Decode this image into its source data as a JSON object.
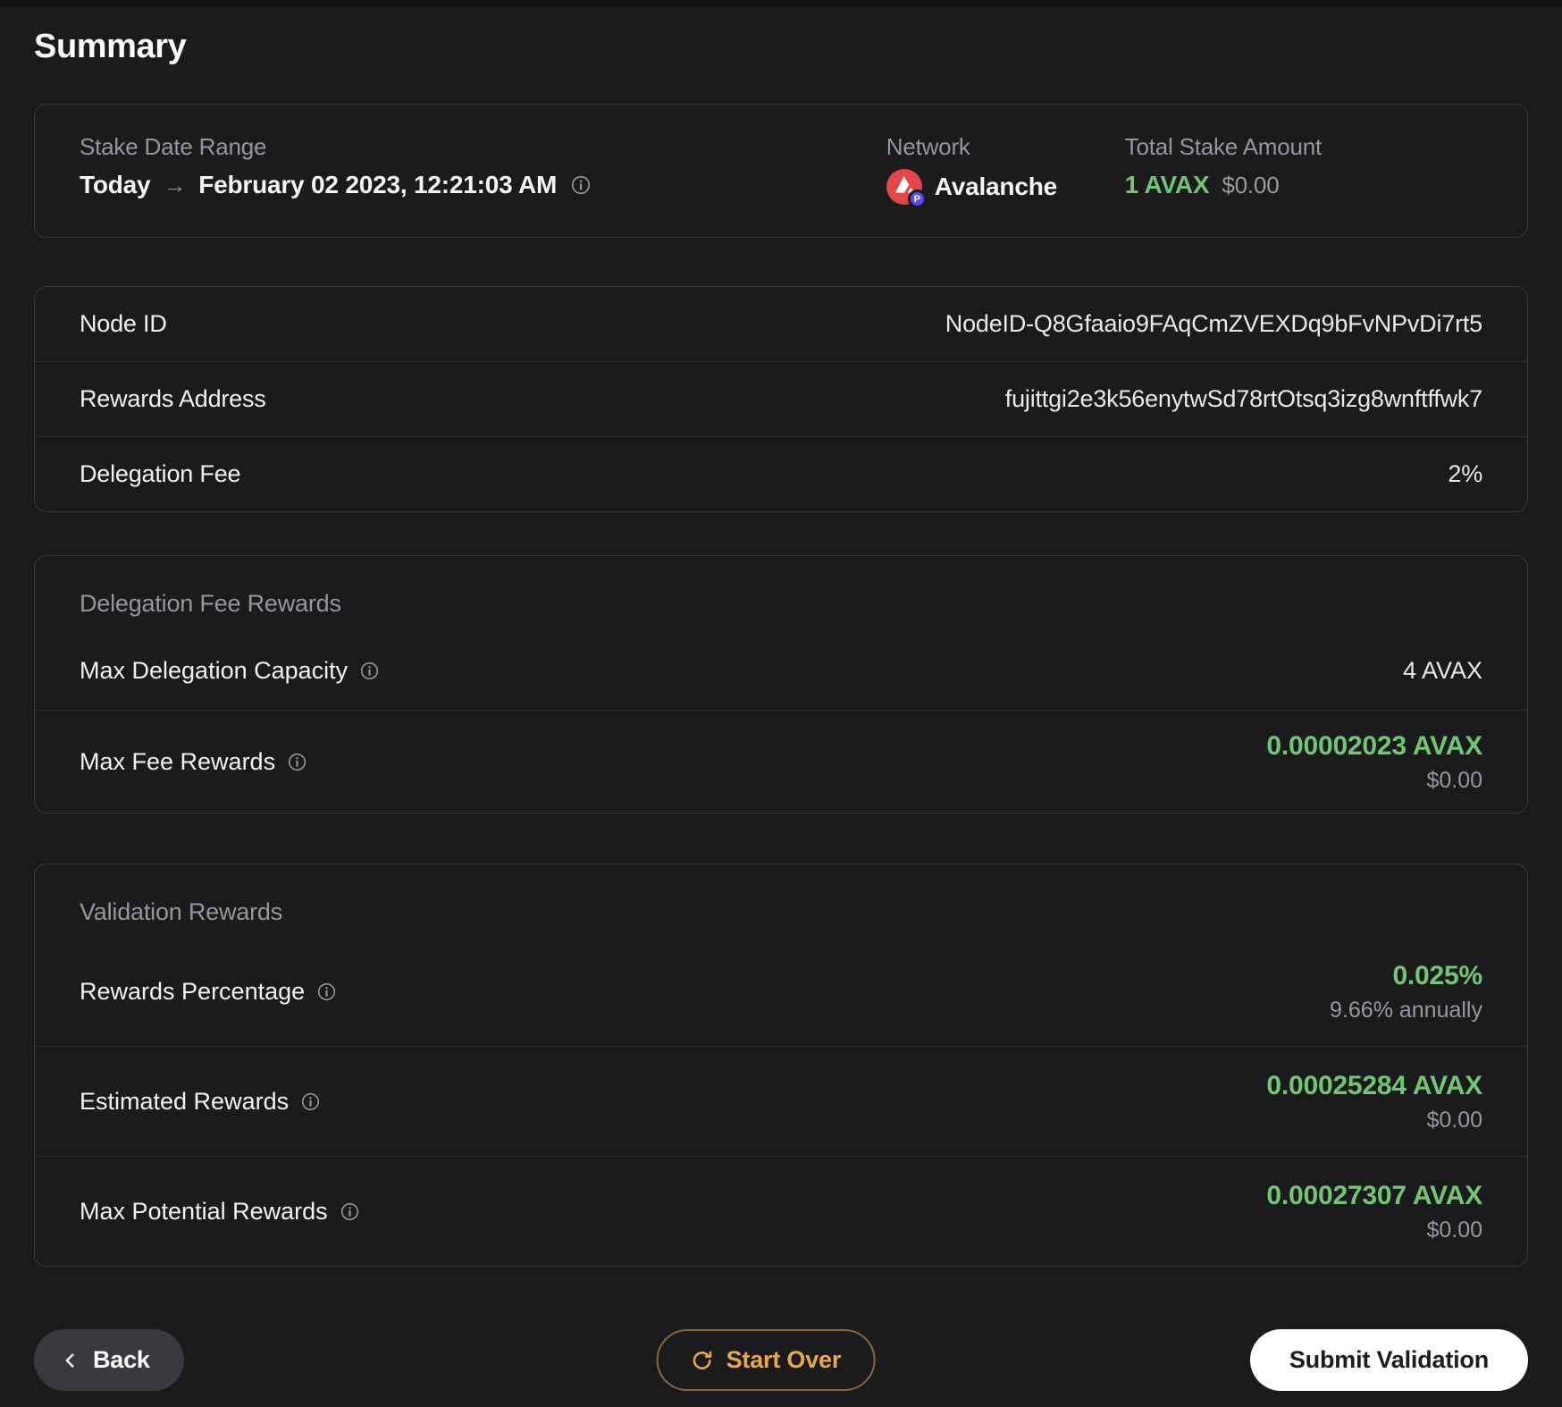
{
  "page": {
    "title": "Summary"
  },
  "overview_card": {
    "stake_date_range": {
      "label": "Stake Date Range",
      "from": "Today",
      "arrow": "→",
      "to": "February 02 2023, 12:21:03 AM"
    },
    "network": {
      "label": "Network",
      "value": "Avalanche"
    },
    "total_stake": {
      "label": "Total Stake Amount",
      "amount": "1 AVAX",
      "usd": "$0.00"
    }
  },
  "details_card": {
    "rows": [
      {
        "label": "Node ID",
        "value": "NodeID-Q8Gfaaio9FAqCmZVEXDq9bFvNPvDi7rt5"
      },
      {
        "label": "Rewards Address",
        "value": "fujittgi2e3k56enytwSd78rtOtsq3izg8wnftffwk7"
      },
      {
        "label": "Delegation Fee",
        "value": "2%"
      }
    ]
  },
  "delegation_fee_rewards_card": {
    "title": "Delegation Fee Rewards",
    "max_delegation_capacity": {
      "label": "Max Delegation Capacity",
      "value": "4 AVAX"
    },
    "max_fee_rewards": {
      "label": "Max Fee Rewards",
      "value": "0.00002023 AVAX",
      "usd": "$0.00"
    }
  },
  "validation_rewards_card": {
    "title": "Validation Rewards",
    "rows": [
      {
        "label": "Rewards Percentage",
        "value": "0.025%",
        "sub": "9.66% annually"
      },
      {
        "label": "Estimated Rewards",
        "value": "0.00025284 AVAX",
        "sub": "$0.00"
      },
      {
        "label": "Max Potential Rewards",
        "value": "0.00027307 AVAX",
        "sub": "$0.00"
      }
    ]
  },
  "footer": {
    "back_label": "Back",
    "start_over_label": "Start Over",
    "submit_label": "Submit Validation"
  },
  "icons": {
    "p_chain_badge": "P"
  },
  "colors": {
    "accent_green": "#72c672",
    "accent_orange": "#e9a64d",
    "avalanche_red": "#e2464b",
    "p_chain_purple": "#5b46f4",
    "background": "#1b1b1e"
  }
}
